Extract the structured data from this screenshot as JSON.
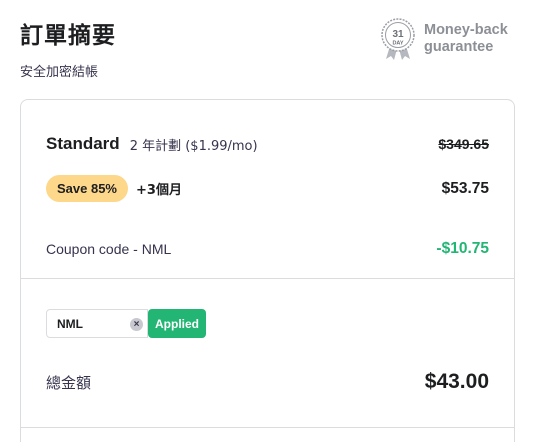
{
  "header": {
    "title": "訂單摘要",
    "subtitle": "安全加密結帳"
  },
  "guarantee": {
    "badge_number": "31",
    "badge_unit": "DAY",
    "line1": "Money-back",
    "line2": "guarantee",
    "icon": "medal-icon"
  },
  "plan": {
    "name": "Standard",
    "term": "2 年計劃 ($1.99/mo)",
    "original_price": "$349.65",
    "save_badge": "Save 85%",
    "bonus": "+3個月",
    "price": "$53.75"
  },
  "coupon": {
    "label": "Coupon code - NML",
    "discount": "-$10.75",
    "input_value": "NML",
    "clear_symbol": "×",
    "applied_label": "Applied"
  },
  "total": {
    "label": "總金額",
    "value": "$43.00"
  },
  "colors": {
    "accent_green": "#22b573",
    "save_badge_bg": "#fdd78a",
    "muted_gray": "#8c8f96",
    "border": "#dadce0"
  }
}
